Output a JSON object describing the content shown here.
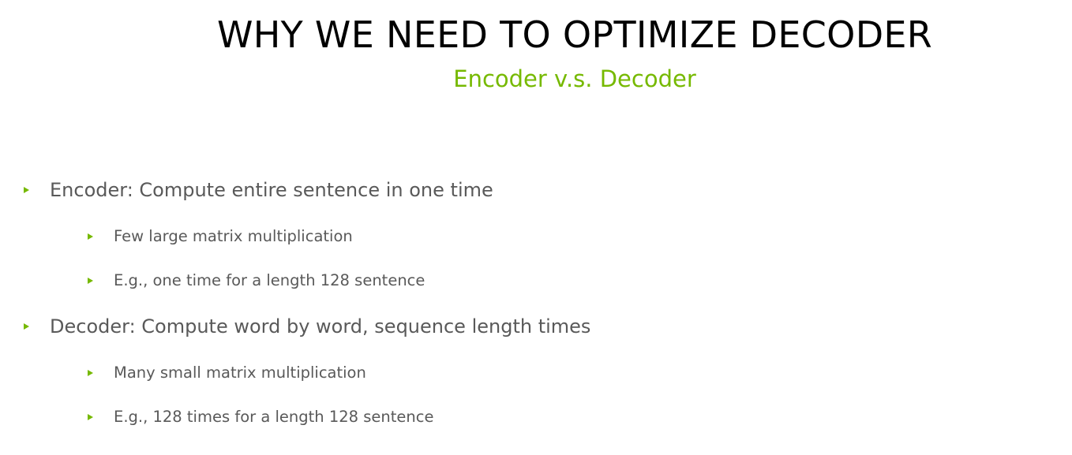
{
  "slide": {
    "title": "WHY WE NEED TO OPTIMIZE DECODER",
    "subtitle": "Encoder v.s. Decoder",
    "accent_color": "#76b900",
    "bullet_icon": "green-triangle-bullet",
    "bullets": [
      {
        "text": "Encoder: Compute entire sentence in one time",
        "sub": [
          "Few large matrix multiplication",
          "E.g., one time for a length 128 sentence"
        ]
      },
      {
        "text": "Decoder: Compute word by word, sequence length times",
        "sub": [
          "Many small matrix multiplication",
          "E.g., 128 times for a length 128 sentence"
        ]
      }
    ]
  }
}
